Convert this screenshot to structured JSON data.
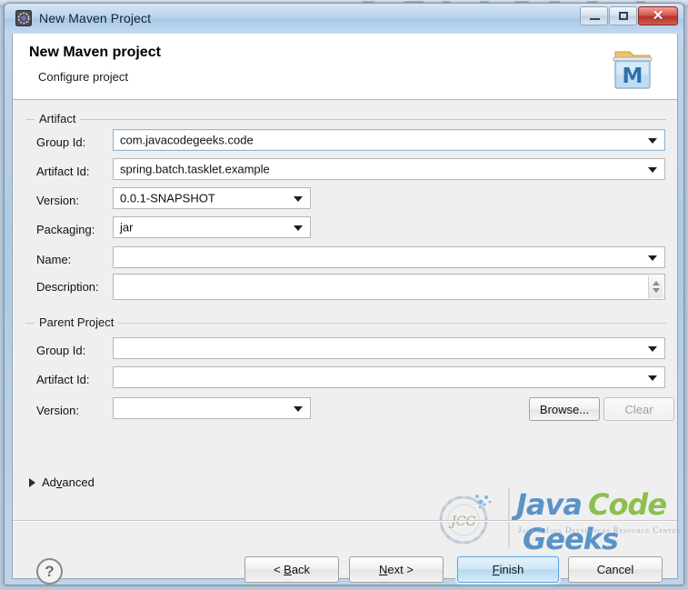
{
  "window": {
    "title": "New Maven Project",
    "icon": "maven-project-icon",
    "controls": {
      "minimize": "minimize-button",
      "maximize": "maximize-button",
      "close_glyph": "✕"
    }
  },
  "header": {
    "title": "New Maven project",
    "subtitle": "Configure project",
    "icon": "maven-banner-icon",
    "maven_letter": "M"
  },
  "artifact": {
    "legend": "Artifact",
    "fields": [
      {
        "label": "Group Id:",
        "value": "com.javacodegeeks.code",
        "type": "combo",
        "focused": true
      },
      {
        "label": "Artifact Id:",
        "value": "spring.batch.tasklet.example",
        "type": "combo",
        "focused": false
      },
      {
        "label": "Version:",
        "value": "0.0.1-SNAPSHOT",
        "type": "combo",
        "focused": false
      },
      {
        "label": "Packaging:",
        "value": "jar",
        "type": "combo",
        "focused": false
      },
      {
        "label": "Name:",
        "value": "",
        "type": "combo",
        "focused": false
      },
      {
        "label": "Description:",
        "value": "",
        "type": "textarea",
        "focused": false
      }
    ]
  },
  "parent_project": {
    "legend": "Parent Project",
    "fields": [
      {
        "label": "Group Id:",
        "value": "",
        "type": "combo"
      },
      {
        "label": "Artifact Id:",
        "value": "",
        "type": "combo"
      },
      {
        "label": "Version:",
        "value": "",
        "type": "combo"
      }
    ],
    "browse_button": "Browse...",
    "clear_button": "Clear"
  },
  "advanced": {
    "label_pre": "Ad",
    "label_mnemonic": "v",
    "label_post": "anced",
    "expanded": false
  },
  "footer": {
    "help": "?",
    "buttons": [
      {
        "pre": "< ",
        "mnemonic": "B",
        "post": "ack",
        "name": "back",
        "state": "normal"
      },
      {
        "pre": "",
        "mnemonic": "N",
        "post": "ext >",
        "name": "next",
        "state": "normal"
      },
      {
        "pre": "",
        "mnemonic": "F",
        "post": "inish",
        "name": "finish",
        "state": "default"
      },
      {
        "pre": "",
        "mnemonic": "C",
        "post": "ancel",
        "name": "cancel",
        "state": "normal"
      }
    ]
  },
  "watermark": {
    "mark": "JCG",
    "word1": "Java",
    "word2": "Code",
    "word3": "Geeks",
    "tagline": "Java 2 Java Developers Resource Center",
    "color_blue": "#5a93c8",
    "color_green": "#8cbf4d"
  }
}
